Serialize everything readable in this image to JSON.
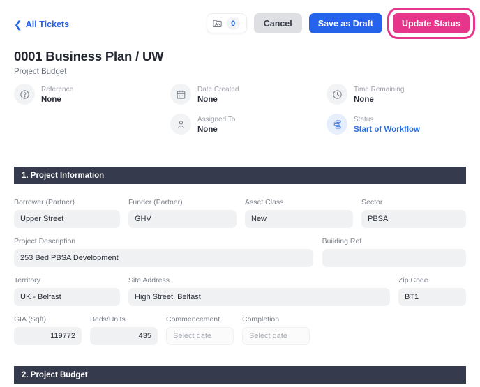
{
  "toolbar": {
    "back_label": "All Tickets",
    "back_icon": "chevron-left-icon",
    "attachments_icon": "folder-image-icon",
    "attachments_count": "0",
    "cancel_label": "Cancel",
    "save_draft_label": "Save as Draft",
    "update_status_label": "Update Status"
  },
  "header": {
    "title": "0001 Business Plan / UW",
    "subtitle": "Project Budget"
  },
  "meta": [
    {
      "icon": "question-circle-icon",
      "label": "Reference",
      "value": "None",
      "accent": false
    },
    {
      "icon": "calendar-icon",
      "label": "Date Created",
      "value": "None",
      "accent": false
    },
    {
      "icon": "clock-icon",
      "label": "Time Remaining",
      "value": "None",
      "accent": false
    },
    {
      "icon": "user-icon",
      "label": "Assigned To",
      "value": "None",
      "accent": false
    },
    {
      "icon": "workflow-icon",
      "label": "Status",
      "value": "Start of Workflow",
      "accent": true
    }
  ],
  "sections": {
    "project_information": "1. Project Information",
    "project_budget": "2. Project Budget"
  },
  "fields": {
    "borrower": {
      "label": "Borrower (Partner)",
      "value": "Upper Street"
    },
    "funder": {
      "label": "Funder (Partner)",
      "value": "GHV"
    },
    "asset_class": {
      "label": "Asset Class",
      "value": "New"
    },
    "sector": {
      "label": "Sector",
      "value": "PBSA"
    },
    "project_description": {
      "label": "Project Description",
      "value": "253 Bed PBSA Development"
    },
    "building_ref": {
      "label": "Building Ref",
      "value": ""
    },
    "territory": {
      "label": "Territory",
      "value": "UK - Belfast"
    },
    "site_address": {
      "label": "Site Address",
      "value": "High Street, Belfast"
    },
    "zip_code": {
      "label": "Zip Code",
      "value": "BT1"
    },
    "gia_sqft": {
      "label": "GIA (Sqft)",
      "value": "119772"
    },
    "beds_units": {
      "label": "Beds/Units",
      "value": "435"
    },
    "commencement": {
      "label": "Commencement",
      "value": "",
      "placeholder": "Select date"
    },
    "completion": {
      "label": "Completion",
      "value": "",
      "placeholder": "Select date"
    }
  },
  "colors": {
    "accent_blue": "#2563eb",
    "accent_pink": "#e6368b",
    "section_dark": "#353b4d",
    "field_bg": "#f0f1f3"
  }
}
